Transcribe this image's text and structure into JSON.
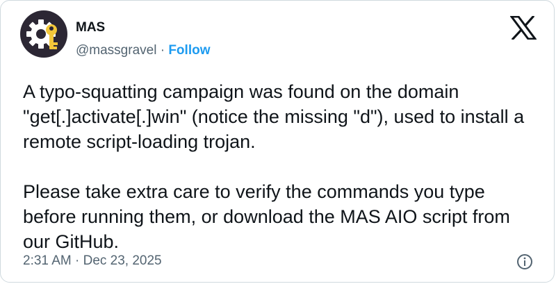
{
  "author": {
    "name": "MAS",
    "handle": "@massgravel",
    "separator": " · ",
    "follow_label": "Follow",
    "avatar_icon": "gear-key-icon"
  },
  "platform_icon": "x-logo-icon",
  "tweet": {
    "paragraphs": [
      "A typo-squatting campaign was found on the domain \"get[.]activate[.]win\" (notice the missing \"d\"), used to install a remote script-loading trojan.",
      "Please take extra care to verify the commands you type before running them, or download the MAS AIO script from our GitHub."
    ]
  },
  "meta": {
    "timestamp": "2:31 AM · Dec 23, 2025",
    "info_icon": "info-icon"
  },
  "colors": {
    "link": "#1d9bf0",
    "secondary_text": "#536471",
    "border": "#cfd9de",
    "avatar_bg": "#2c2734",
    "key": "#f3c73a"
  }
}
